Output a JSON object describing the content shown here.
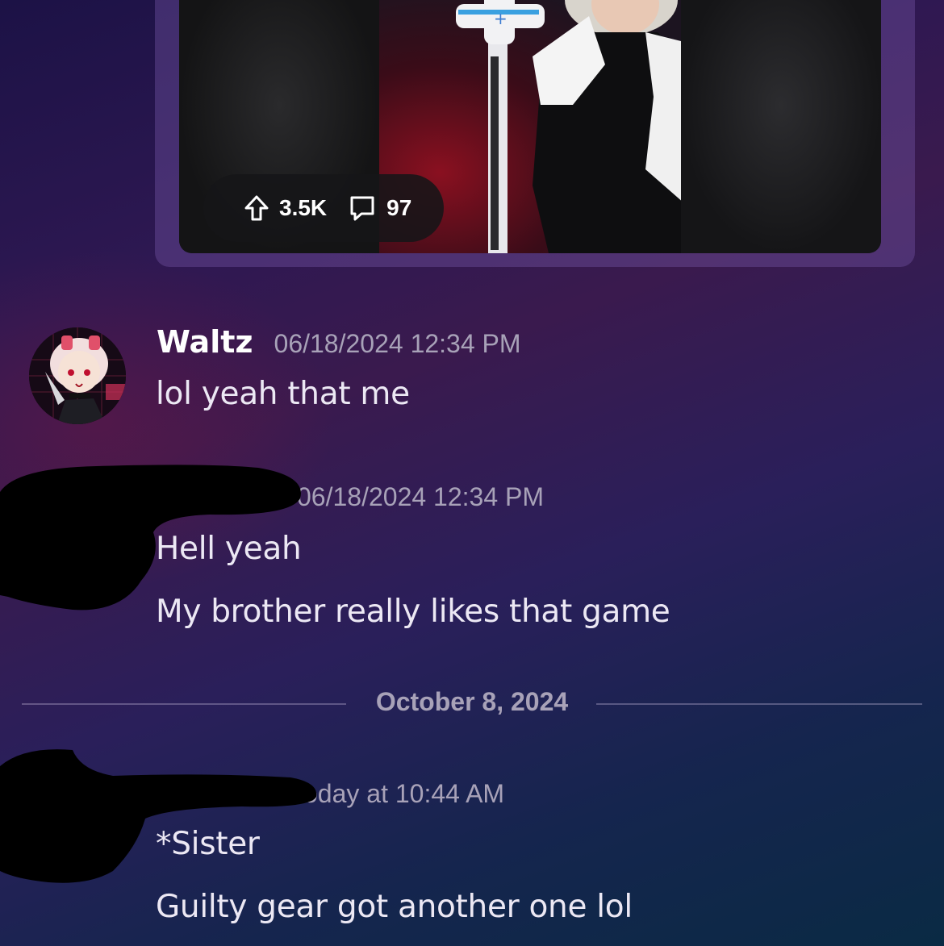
{
  "embed": {
    "upvotes": "3.5K",
    "comments": "97"
  },
  "messages": [
    {
      "username": "Waltz",
      "timestamp": "06/18/2024 12:34 PM",
      "lines": [
        "lol yeah that me"
      ]
    },
    {
      "username": "",
      "timestamp": "06/18/2024 12:34 PM",
      "lines": [
        "Hell yeah",
        "My brother really likes that game"
      ]
    },
    {
      "username": "",
      "timestamp": "Today at 10:44 AM",
      "lines": [
        "*Sister",
        "Guilty gear got another one lol"
      ]
    }
  ],
  "date_divider": "October 8, 2024",
  "icons": {
    "upvote": "arrow-up-icon",
    "comment": "comment-bubble-icon"
  },
  "colors": {
    "card_bg": "#6a5a9a",
    "timestamp": "#a8a2b8",
    "text": "#ece8f4"
  }
}
